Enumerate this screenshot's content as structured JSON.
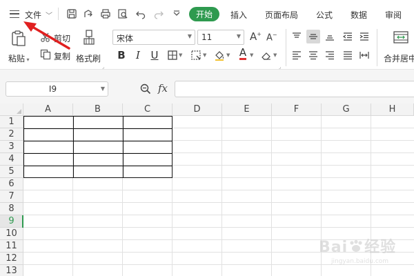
{
  "menubar": {
    "file_label": "文件",
    "tabs": {
      "home": "开始",
      "insert": "插入",
      "page_layout": "页面布局",
      "formulas": "公式",
      "data": "数据",
      "review": "审阅"
    },
    "active_tab_color": "#2e9a4f",
    "quick_access_icons": [
      "save-icon",
      "export-icon",
      "print-icon",
      "print-preview-icon",
      "undo-icon",
      "redo-icon",
      "more-icon"
    ]
  },
  "ribbon": {
    "paste_label": "粘贴",
    "cut_label": "剪切",
    "copy_label": "复制",
    "format_painter_label": "格式刷",
    "font_name": "宋体",
    "font_size": "11",
    "bold": "B",
    "italic": "I",
    "underline": "U",
    "font_color_letter": "A",
    "font_color_accent": "#e03232",
    "merge_label": "合并居中"
  },
  "formula_bar": {
    "name_box": "I9",
    "fx": "fx",
    "formula": ""
  },
  "sheet": {
    "columns": [
      "A",
      "B",
      "C",
      "D",
      "E",
      "F",
      "G",
      "H"
    ],
    "rows": [
      "1",
      "2",
      "3",
      "4",
      "5",
      "6",
      "7",
      "8",
      "9",
      "10",
      "11",
      "12",
      "13"
    ],
    "active_row": "9",
    "accent": "#2e9a4f"
  },
  "watermark": {
    "title": "Bai",
    "title2": "经验",
    "sub": "jingyan.baidu.com"
  },
  "annotation": {
    "arrow_color": "#e02020"
  }
}
